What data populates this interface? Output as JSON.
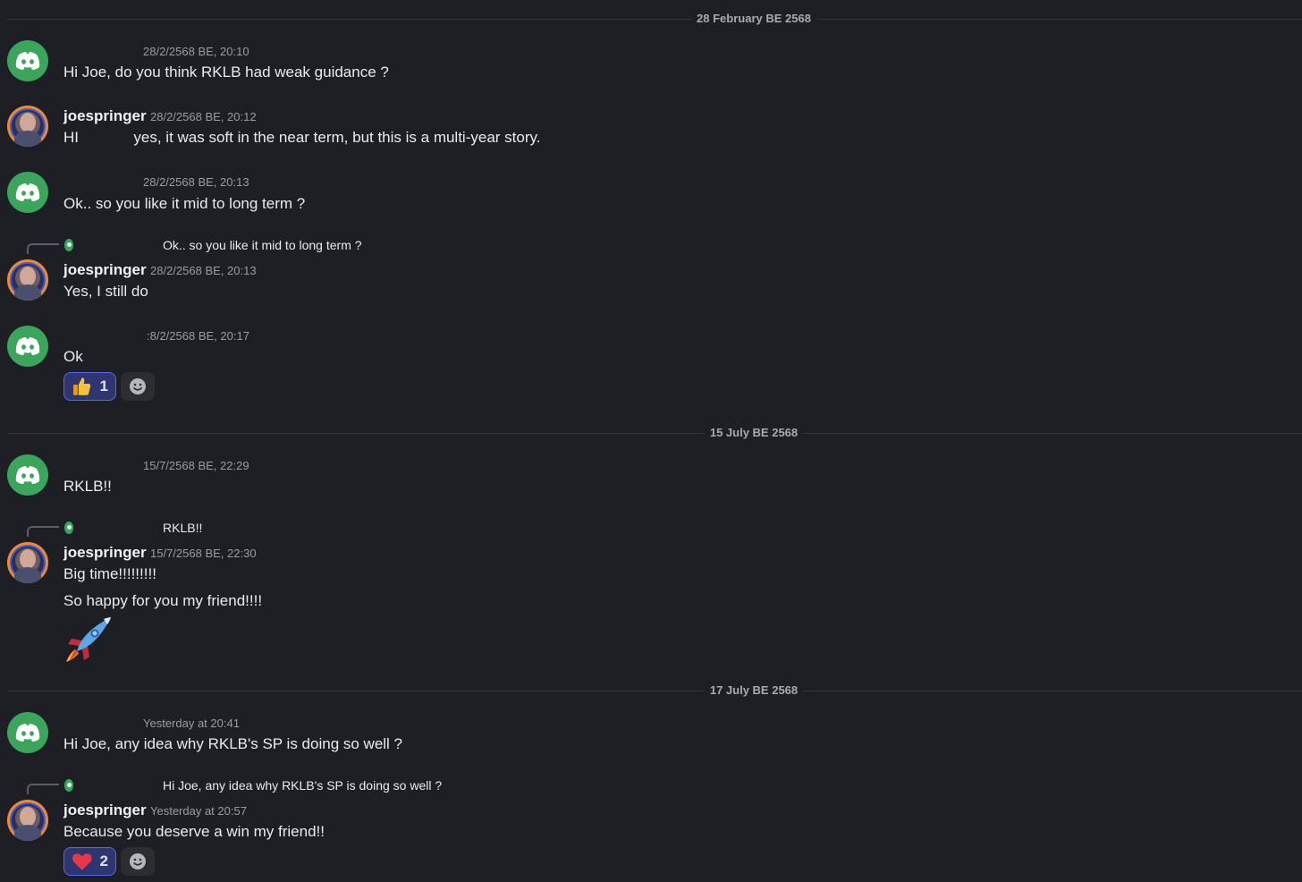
{
  "dividers": [
    "28 February BE 2568",
    "15 July BE 2568",
    "17 July BE 2568"
  ],
  "messages": [
    {
      "author": "",
      "timestamp": "28/2/2568 BE, 20:10",
      "text": "Hi Joe, do you think RKLB had weak guidance ?"
    },
    {
      "author": "joespringer",
      "timestamp": "28/2/2568 BE, 20:12",
      "text": "HI             yes, it was soft in the near term, but this is a multi-year story."
    },
    {
      "author": "",
      "timestamp": "28/2/2568 BE, 20:13",
      "text": "Ok.. so you like it mid to long term ?"
    },
    {
      "reply": "Ok.. so you like it mid to long term ?",
      "author": "joespringer",
      "timestamp": "28/2/2568 BE, 20:13",
      "text": "Yes, I still do"
    },
    {
      "author": "",
      "timestamp": ":8/2/2568 BE, 20:17",
      "text": "Ok",
      "reaction_count": "1",
      "reaction_icon": "thumbs-up-icon"
    },
    {
      "author": "",
      "timestamp": "15/7/2568 BE, 22:29",
      "text": "RKLB!!"
    },
    {
      "reply": "RKLB!!",
      "author": "joespringer",
      "timestamp": "15/7/2568 BE, 22:30",
      "text": "Big time!!!!!!!!!",
      "text2": "So happy for you my friend!!!!",
      "emoji": "rocket-icon"
    },
    {
      "author": "",
      "timestamp": "Yesterday at 20:41",
      "text": "Hi Joe, any idea why RKLB's SP is doing so well ?"
    },
    {
      "reply": "Hi Joe, any idea why RKLB's SP is doing so well ?",
      "author": "joespringer",
      "timestamp": "Yesterday at 20:57",
      "text": "Because you deserve a win my friend!!",
      "reaction_count": "2",
      "reaction_icon": "heart-icon"
    }
  ],
  "colors": {
    "background": "#1e1f24",
    "discord_green": "#3ba55c",
    "reaction_blurple": "#5865f2"
  }
}
